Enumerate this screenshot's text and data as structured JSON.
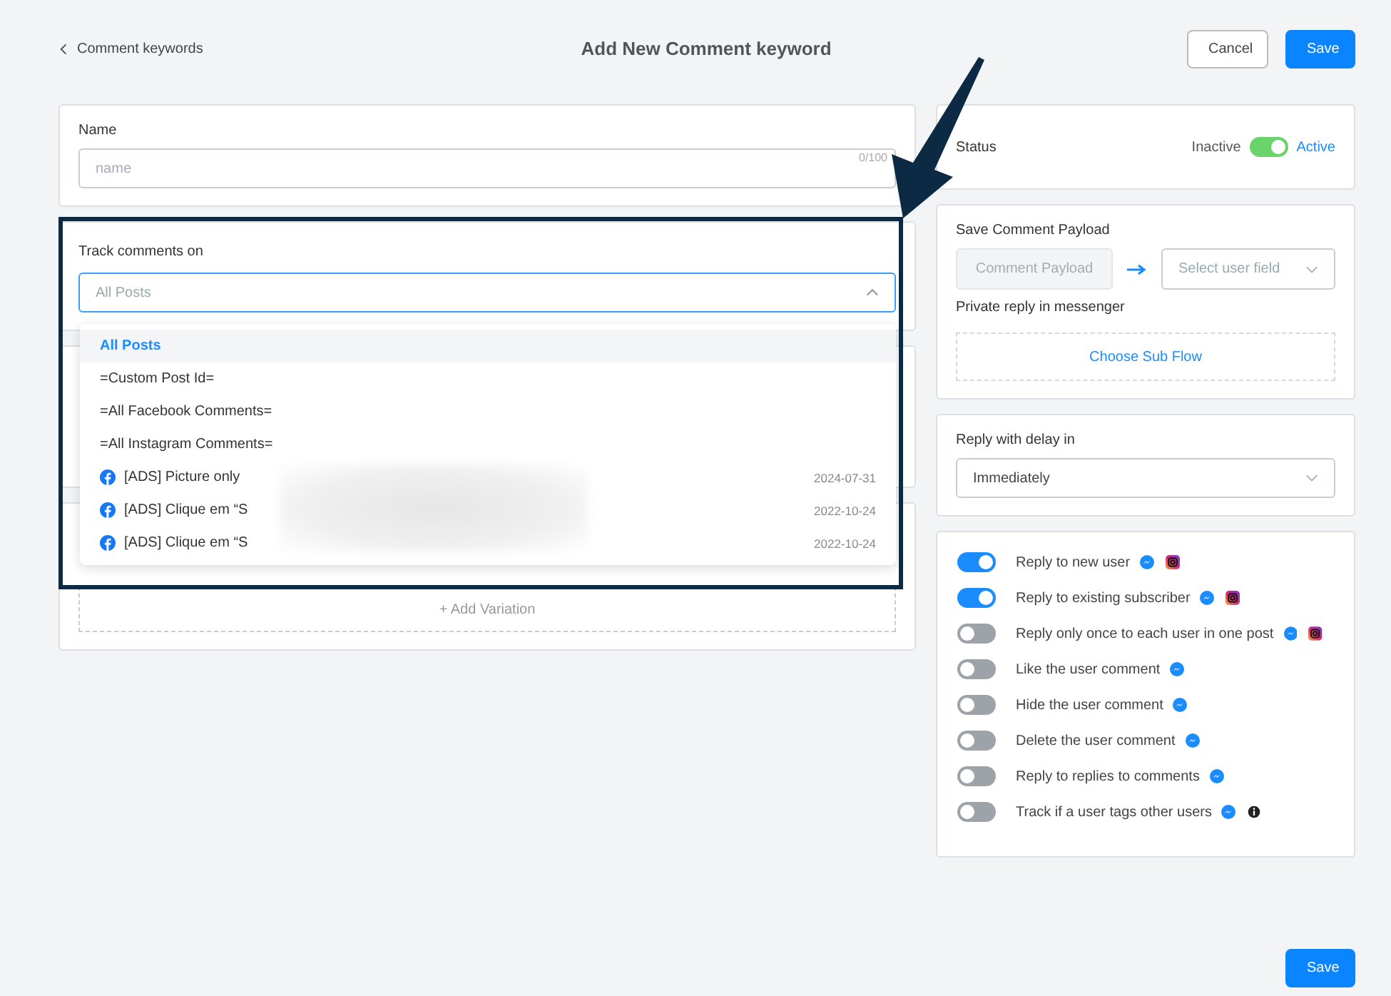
{
  "header": {
    "back_link": "Comment keywords",
    "title": "Add New Comment keyword",
    "cancel": "Cancel",
    "save": "Save"
  },
  "name_field": {
    "label": "Name",
    "placeholder": "name",
    "counter": "0/100"
  },
  "track": {
    "label": "Track comments on",
    "placeholder": "All Posts",
    "options": [
      {
        "kind": "option",
        "label": "All Posts",
        "selected": true
      },
      {
        "kind": "option",
        "label": "=Custom Post Id=",
        "selected": false
      },
      {
        "kind": "option",
        "label": "=All Facebook Comments=",
        "selected": false
      },
      {
        "kind": "option",
        "label": "=All Instagram Comments=",
        "selected": false
      },
      {
        "kind": "post",
        "label": "[ADS] Picture only",
        "date": "2024-07-31",
        "selected": false
      },
      {
        "kind": "post",
        "label": "[ADS] Clique em “S",
        "date": "2022-10-24",
        "selected": false
      },
      {
        "kind": "post",
        "label": "[ADS] Clique em “S",
        "date": "2022-10-24",
        "selected": false
      }
    ]
  },
  "add_variation": "+ Add Variation",
  "status": {
    "label": "Status",
    "off_label": "Inactive",
    "on_label": "Active",
    "on": true
  },
  "payload": {
    "label": "Save Comment Payload",
    "source": "Comment Payload",
    "target_placeholder": "Select user field",
    "private_reply_label": "Private reply in messenger",
    "sub_flow": "Choose Sub Flow"
  },
  "delay": {
    "label": "Reply with delay in",
    "value": "Immediately"
  },
  "options": [
    {
      "label": "Reply to new user",
      "on": true,
      "instagram": true,
      "info": false
    },
    {
      "label": "Reply to existing subscriber",
      "on": true,
      "instagram": true,
      "info": false
    },
    {
      "label": "Reply only once to each user in one post",
      "on": false,
      "instagram": true,
      "info": false
    },
    {
      "label": "Like the user comment",
      "on": false,
      "instagram": false,
      "info": false
    },
    {
      "label": "Hide the user comment",
      "on": false,
      "instagram": false,
      "info": false
    },
    {
      "label": "Delete the user comment",
      "on": false,
      "instagram": false,
      "info": false
    },
    {
      "label": "Reply to replies to comments",
      "on": false,
      "instagram": false,
      "info": false
    },
    {
      "label": "Track if a user tags other users",
      "on": false,
      "instagram": false,
      "info": true
    }
  ],
  "footer": {
    "save": "Save"
  }
}
